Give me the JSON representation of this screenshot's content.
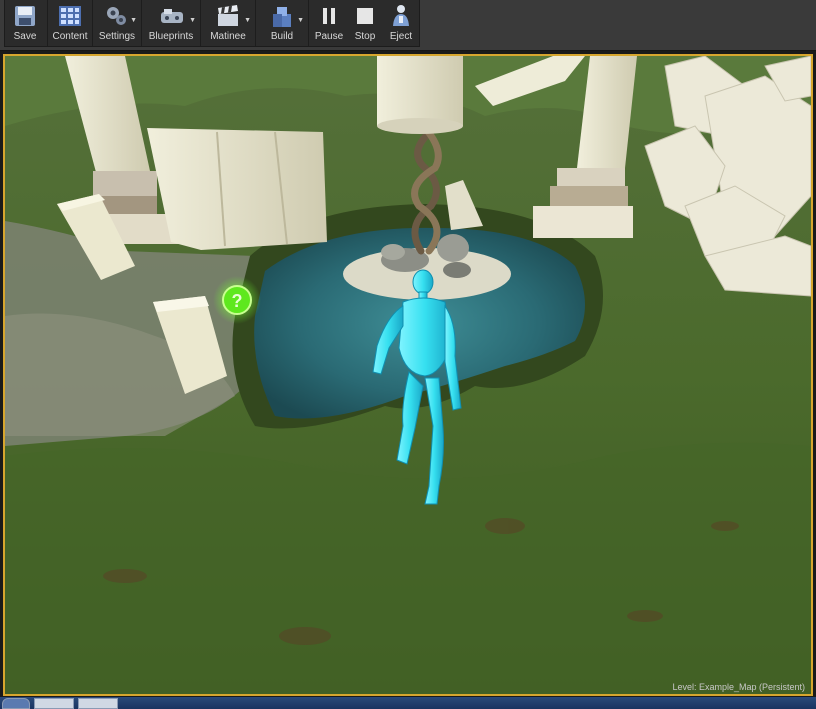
{
  "toolbar": {
    "buttons": [
      {
        "label": "Save",
        "icon": "save-icon"
      },
      {
        "label": "Content",
        "icon": "content-browser-icon"
      },
      {
        "label": "Settings",
        "icon": "settings-icon"
      },
      {
        "label": "Blueprints",
        "icon": "blueprints-icon"
      },
      {
        "label": "Matinee",
        "icon": "matinee-icon"
      },
      {
        "label": "Build",
        "icon": "build-icon"
      },
      {
        "label": "Pause",
        "icon": "pause-icon"
      },
      {
        "label": "Stop",
        "icon": "stop-icon"
      },
      {
        "label": "Eject",
        "icon": "eject-icon"
      }
    ]
  },
  "viewport": {
    "level_label": "Level:  Example_Map (Persistent)",
    "border_color": "#d7a62e"
  },
  "colors": {
    "toolbar_bg": "#2b2b2b",
    "grass": "#4a6a2e",
    "water": "#2f6f78",
    "character": "#36e0f0",
    "hint_icon": "#6dff2e"
  }
}
